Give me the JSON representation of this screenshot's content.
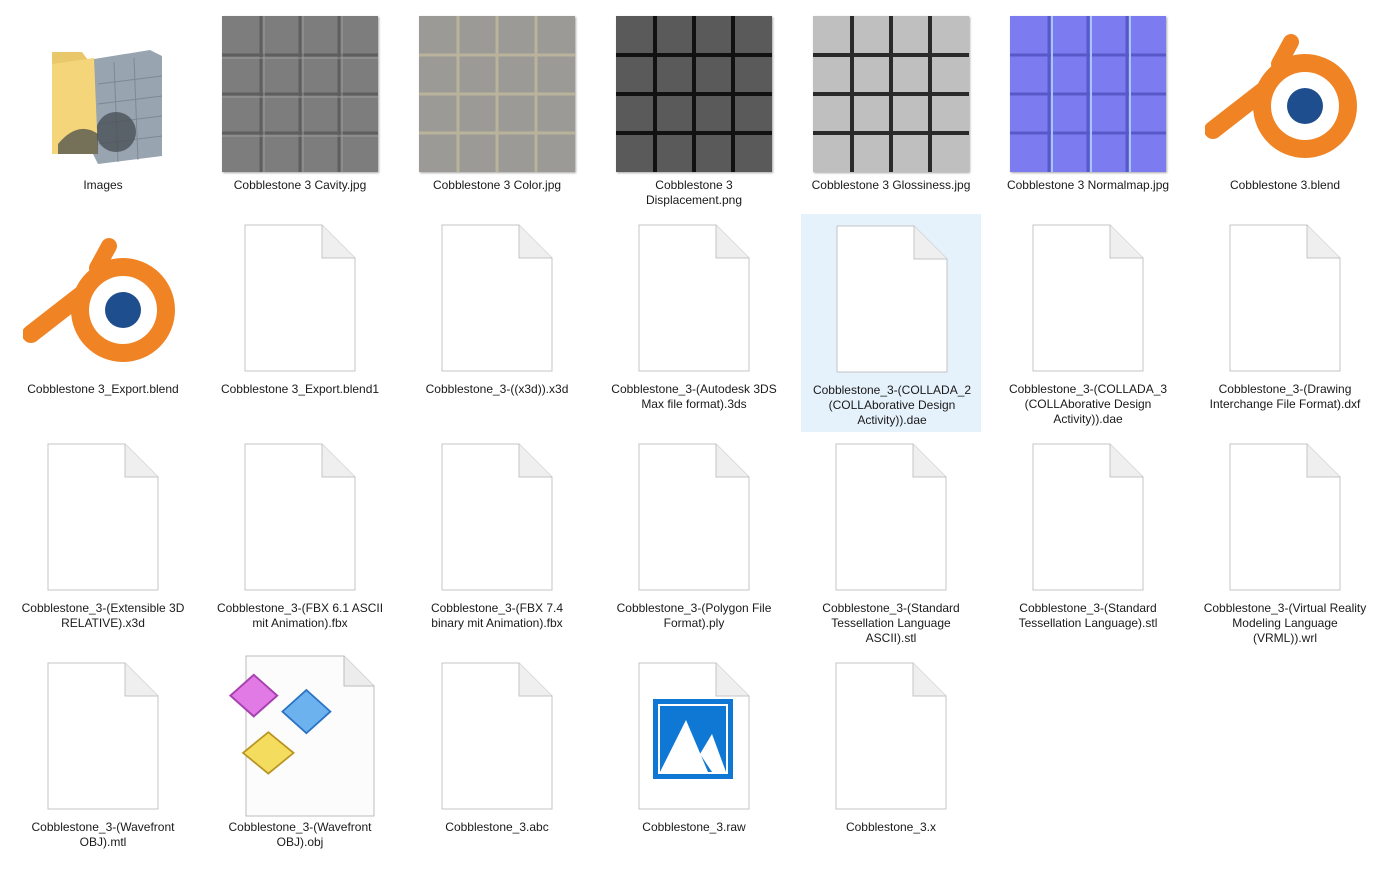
{
  "items": [
    {
      "label": "Images",
      "icon": "folder-icon"
    },
    {
      "label": "Cobblestone 3 Cavity.jpg",
      "icon": "texture-thumb"
    },
    {
      "label": "Cobblestone 3 Color.jpg",
      "icon": "texture-thumb"
    },
    {
      "label": "Cobblestone 3 Displacement.png",
      "icon": "texture-thumb"
    },
    {
      "label": "Cobblestone 3 Glossiness.jpg",
      "icon": "texture-thumb"
    },
    {
      "label": "Cobblestone 3 Normalmap.jpg",
      "icon": "texture-thumb"
    },
    {
      "label": "Cobblestone 3.blend",
      "icon": "blender-icon"
    },
    {
      "label": "Cobblestone 3_Export.blend",
      "icon": "blender-icon"
    },
    {
      "label": "Cobblestone 3_Export.blend1",
      "icon": "generic-file-icon"
    },
    {
      "label": "Cobblestone_3-((x3d)).x3d",
      "icon": "generic-file-icon"
    },
    {
      "label": "Cobblestone_3-(Autodesk 3DS Max file format).3ds",
      "icon": "generic-file-icon"
    },
    {
      "label": "Cobblestone_3-(COLLADA_2 (COLLAborative Design Activity)).dae",
      "icon": "generic-file-icon"
    },
    {
      "label": "Cobblestone_3-(COLLADA_3 (COLLAborative Design Activity)).dae",
      "icon": "generic-file-icon"
    },
    {
      "label": "Cobblestone_3-(Drawing Interchange File Format).dxf",
      "icon": "generic-file-icon"
    },
    {
      "label": "Cobblestone_3-(Extensible 3D RELATIVE).x3d",
      "icon": "generic-file-icon"
    },
    {
      "label": "Cobblestone_3-(FBX 6.1 ASCII mit Animation).fbx",
      "icon": "generic-file-icon"
    },
    {
      "label": "Cobblestone_3-(FBX 7.4 binary mit Animation).fbx",
      "icon": "generic-file-icon"
    },
    {
      "label": "Cobblestone_3-(Polygon File Format).ply",
      "icon": "generic-file-icon"
    },
    {
      "label": "Cobblestone_3-(Standard Tessellation Language ASCII).stl",
      "icon": "generic-file-icon"
    },
    {
      "label": "Cobblestone_3-(Standard Tessellation Language).stl",
      "icon": "generic-file-icon"
    },
    {
      "label": "Cobblestone_3-(Virtual Reality Modeling Language (VRML)).wrl",
      "icon": "generic-file-icon"
    },
    {
      "label": "Cobblestone_3-(Wavefront OBJ).mtl",
      "icon": "generic-file-icon"
    },
    {
      "label": "Cobblestone_3-(Wavefront OBJ).obj",
      "icon": "obj-file-icon"
    },
    {
      "label": "Cobblestone_3.abc",
      "icon": "generic-file-icon"
    },
    {
      "label": "Cobblestone_3.raw",
      "icon": "image-file-icon"
    },
    {
      "label": "Cobblestone_3.x",
      "icon": "generic-file-icon"
    }
  ],
  "selected_item": "Cobblestone_3-(COLLADA_2 (COLLAborative Design Activity)).dae",
  "colors": {
    "selection": "#e5f1fb",
    "blender_orange": "#f08323",
    "blender_blue": "#1f4e8f",
    "photos_blue": "#0f78d4"
  }
}
